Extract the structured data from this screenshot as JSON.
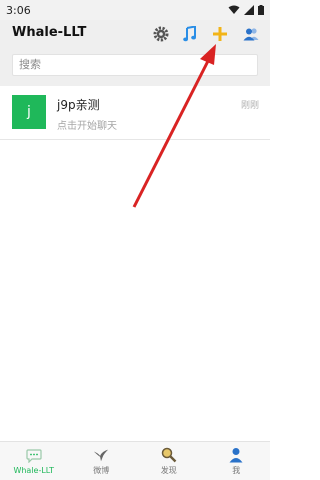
{
  "status_bar": {
    "time": "3:06"
  },
  "header": {
    "title": "Whale-LLT"
  },
  "search": {
    "placeholder": "搜索"
  },
  "chats": [
    {
      "avatar_letter": "j",
      "name": "j9p亲测",
      "preview": "点击开始聊天",
      "time": "刚刚"
    }
  ],
  "tabs": [
    {
      "label": "Whale-LLT",
      "icon": "chat-bubble-icon",
      "active": true
    },
    {
      "label": "微博",
      "icon": "bird-icon",
      "active": false
    },
    {
      "label": "发现",
      "icon": "magnifier-icon",
      "active": false
    },
    {
      "label": "我",
      "icon": "person-icon",
      "active": false
    }
  ],
  "colors": {
    "accent": "#1fb85a",
    "annotation_arrow": "#d92323",
    "plus_icon": "#f2b418",
    "music_icon": "#2a8ee6"
  }
}
